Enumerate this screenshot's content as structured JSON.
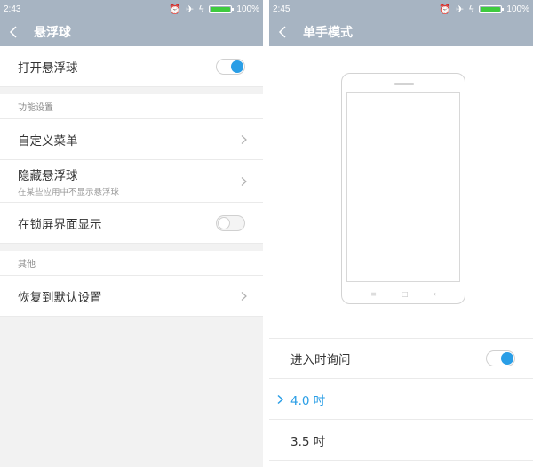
{
  "left": {
    "status": {
      "time": "2:43",
      "battery": "100%",
      "battery_level": 1.0
    },
    "title": "悬浮球",
    "rows": {
      "open": {
        "label": "打开悬浮球",
        "enabled": true
      },
      "section1": "功能设置",
      "custom_menu": {
        "label": "自定义菜单"
      },
      "hide": {
        "label": "隐藏悬浮球",
        "sub": "在某些应用中不显示悬浮球"
      },
      "lockscreen": {
        "label": "在锁屏界面显示",
        "enabled": false
      },
      "section2": "其他",
      "reset": {
        "label": "恢复到默认设置"
      }
    }
  },
  "right": {
    "status": {
      "time": "2:45",
      "battery": "100%",
      "battery_level": 1.0
    },
    "title": "单手模式",
    "rows": {
      "ask": {
        "label": "进入时询问",
        "enabled": true
      },
      "size_40": {
        "label": "4.0 吋",
        "selected": true
      },
      "size_35": {
        "label": "3.5 吋",
        "selected": false
      }
    }
  },
  "icons": {
    "back": "chevron-left-icon",
    "chevron": "chevron-right-icon",
    "alarm": "alarm-off-icon",
    "airplane": "airplane-icon",
    "charging": "charging-bolt-icon",
    "battery": "battery-icon"
  },
  "colors": {
    "accent": "#2a9ee6",
    "header": "#a7b4c2",
    "battery": "#3ecb3e"
  }
}
